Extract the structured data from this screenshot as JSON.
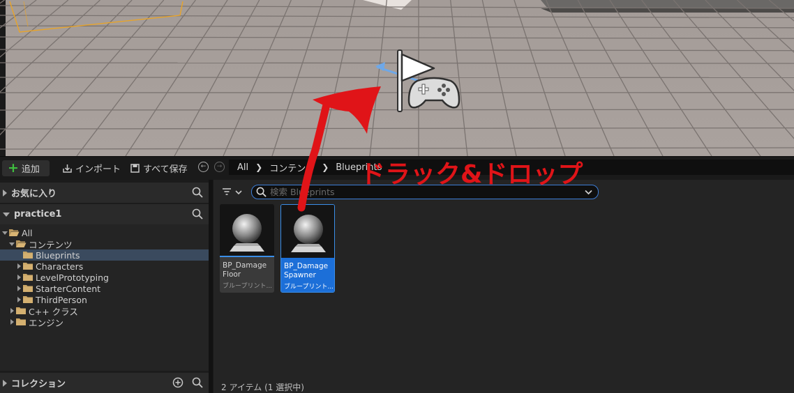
{
  "toolbar": {
    "add_label": "追加",
    "import_label": "インポート",
    "saveall_label": "すべて保存"
  },
  "breadcrumb": [
    "All",
    "コンテンツ",
    "Blueprints"
  ],
  "left_panel": {
    "favorites_label": "お気に入り",
    "project_label": "practice1",
    "collections_label": "コレクション",
    "tree": [
      {
        "label": "All",
        "depth": 0,
        "expanded": true
      },
      {
        "label": "コンテンツ",
        "depth": 1,
        "expanded": true
      },
      {
        "label": "Blueprints",
        "depth": 2,
        "selected": true
      },
      {
        "label": "Characters",
        "depth": 2
      },
      {
        "label": "LevelPrototyping",
        "depth": 2
      },
      {
        "label": "StarterContent",
        "depth": 2
      },
      {
        "label": "ThirdPerson",
        "depth": 2
      },
      {
        "label": "C++ クラス",
        "depth": 1
      },
      {
        "label": "エンジン",
        "depth": 1
      }
    ]
  },
  "search": {
    "placeholder": "検索 Blueprints"
  },
  "assets": [
    {
      "name_line1": "BP_Damage",
      "name_line2": "Floor",
      "type": "ブループリント...",
      "selected": false
    },
    {
      "name_line1": "BP_Damage",
      "name_line2": "Spawner",
      "type": "ブループリント...",
      "selected": true
    }
  ],
  "status": "2 アイテム (1 選択中)",
  "annotation": {
    "text": "ドラック&ドロップ",
    "color": "#e01418"
  },
  "colors": {
    "accent_blue": "#1c6fd8",
    "add_green": "#3fbf3f",
    "folder": "#c8a464"
  },
  "icons": [
    "plus-icon",
    "import-icon",
    "save-icon",
    "back-arrow-icon",
    "forward-arrow-icon",
    "search-icon",
    "filter-icon",
    "chevron-down-icon",
    "folder-icon",
    "player-start-flag-icon",
    "gamepad-icon",
    "add-circle-icon"
  ]
}
